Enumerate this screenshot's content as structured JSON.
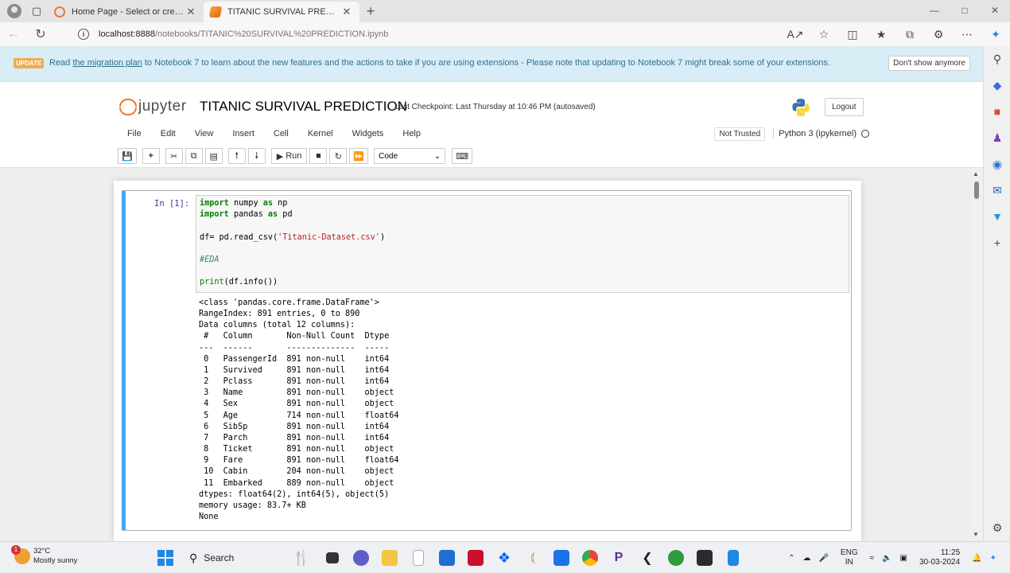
{
  "browser": {
    "tabs": [
      {
        "title": "Home Page - Select or create a n"
      },
      {
        "title": "TITANIC SURVIVAL PREDICTION"
      }
    ],
    "url_host": "localhost:8888",
    "url_path": "/notebooks/TITANIC%20SURVIVAL%20PREDICTION.ipynb"
  },
  "banner": {
    "badge": "UPDATE",
    "text_before": "Read ",
    "link": "the migration plan",
    "text_after": " to Notebook 7 to learn about the new features and the actions to take if you are using extensions - Please note that updating to Notebook 7 might break some of your extensions.",
    "dismiss": "Don't show anymore"
  },
  "header": {
    "logo_text": "jupyter",
    "title": "TITANIC SURVIVAL PREDICTION",
    "checkpoint": "Last Checkpoint: Last Thursday at 10:46 PM  (autosaved)",
    "logout": "Logout"
  },
  "menu": {
    "items": [
      "File",
      "Edit",
      "View",
      "Insert",
      "Cell",
      "Kernel",
      "Widgets",
      "Help"
    ],
    "trust": "Not Trusted",
    "kernel": "Python 3 (ipykernel)"
  },
  "toolbar": {
    "run": "Run",
    "cell_type": "Code"
  },
  "cell": {
    "prompt": "In [1]:",
    "output": "<class 'pandas.core.frame.DataFrame'>\nRangeIndex: 891 entries, 0 to 890\nData columns (total 12 columns):\n #   Column       Non-Null Count  Dtype  \n---  ------       --------------  -----  \n 0   PassengerId  891 non-null    int64  \n 1   Survived     891 non-null    int64  \n 2   Pclass       891 non-null    int64  \n 3   Name         891 non-null    object \n 4   Sex          891 non-null    object \n 5   Age          714 non-null    float64\n 6   SibSp        891 non-null    int64  \n 7   Parch        891 non-null    int64  \n 8   Ticket       891 non-null    object \n 9   Fare         891 non-null    float64\n 10  Cabin        204 non-null    object \n 11  Embarked     889 non-null    object \ndtypes: float64(2), int64(5), object(5)\nmemory usage: 83.7+ KB\nNone"
  },
  "code": {
    "l1_kw": "import",
    "l1_rest": " numpy ",
    "l1_as": "as",
    "l1_alias": " np",
    "l2_kw": "import",
    "l2_rest": " pandas ",
    "l2_as": "as",
    "l2_alias": " pd",
    "l3_pre": "df= pd.read_csv(",
    "l3_str": "'Titanic-Dataset.csv'",
    "l3_post": ")",
    "l4_comment": "#EDA",
    "l5_fn": "print",
    "l5_rest": "(df.info())"
  },
  "taskbar": {
    "temp": "32°C",
    "weather": "Mostly sunny",
    "weather_badge": "1",
    "search": "Search",
    "lang1": "ENG",
    "lang2": "IN",
    "time": "11:25",
    "date": "30-03-2024"
  },
  "colors": {
    "cell_selected_border": "#42a5f5",
    "banner_bg": "#d9edf7",
    "jupyter_orange": "#f37726"
  }
}
